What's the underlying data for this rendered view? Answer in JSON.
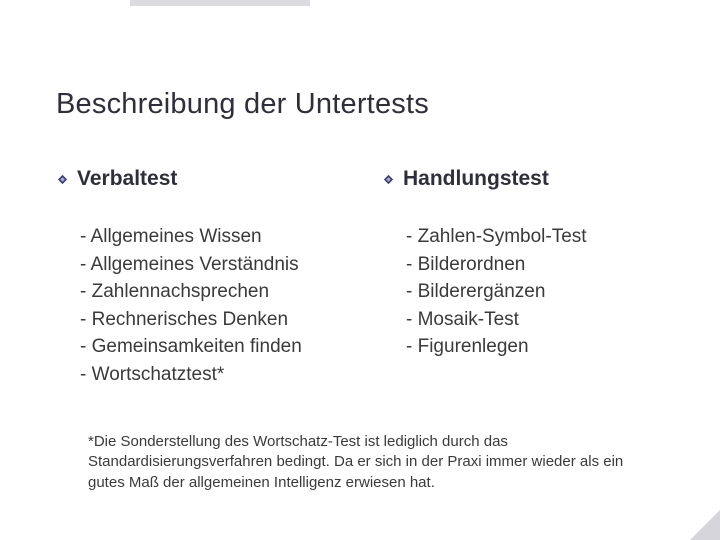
{
  "title": "Beschreibung der Untertests",
  "left": {
    "heading": "Verbaltest",
    "items": [
      "- Allgemeines Wissen",
      "- Allgemeines Verständnis",
      "- Zahlennachsprechen",
      "- Rechnerisches Denken",
      "- Gemeinsamkeiten finden",
      "- Wortschatztest*"
    ]
  },
  "right": {
    "heading": "Handlungstest",
    "items": [
      "- Zahlen-Symbol-Test",
      "- Bilderordnen",
      "- Bilderergänzen",
      "- Mosaik-Test",
      "- Figurenlegen"
    ]
  },
  "footnote": "*Die Sonderstellung des Wortschatz-Test ist lediglich durch das Standardisierungsverfahren bedingt. Da er sich in der Praxi immer wieder als ein gutes Maß der allgemeinen Intelligenz erwiesen hat."
}
